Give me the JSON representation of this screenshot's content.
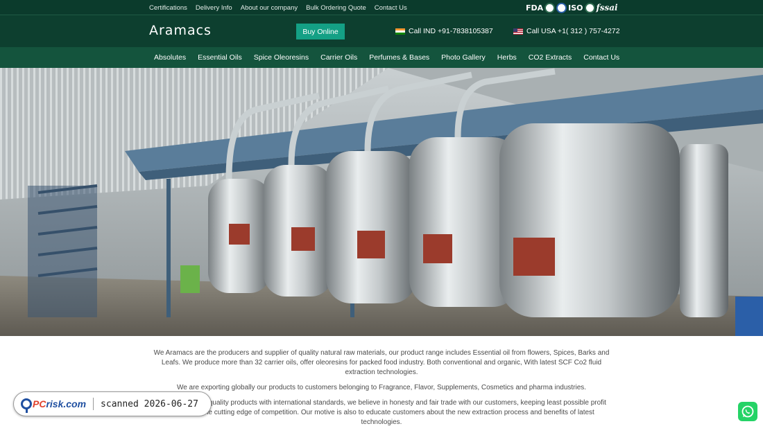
{
  "topbar": {
    "links": [
      "Certifications",
      "Delivery Info",
      "About our company",
      "Bulk Ordering Quote",
      "Contact Us"
    ],
    "certifications": [
      "FDA",
      "ISO",
      "fssai"
    ]
  },
  "header": {
    "logo": "Aramacs",
    "buy_online": "Buy Online",
    "call_ind": "Call IND +91-7838105387",
    "call_usa": "Call USA +1( 312 ) 757-4272"
  },
  "nav": {
    "items": [
      "Absolutes",
      "Essential Oils",
      "Spice Oleoresins",
      "Carrier Oils",
      "Perfumes & Bases",
      "Photo Gallery",
      "Herbs",
      "CO2 Extracts",
      "Contact Us"
    ]
  },
  "content": {
    "para1": "We Aramacs are the producers and supplier of quality natural raw materials, our product range includes Essential oil from flowers, Spices, Barks and Leafs. We produce more than 32 carrier oils, offer oleoresins for packed food industry. Both conventional and organic, With latest SCF Co2 fluid extraction technologies.",
    "para2": "We are exporting globally our products to customers belonging to Fragrance, Flavor, Supplements, Cosmetics and pharma industries.",
    "para3": "We provide high quality products with international standards, we believe in honesty and fair trade with our customers, keeping least possible profit margins in the cutting edge of competition. Our motive is also to educate customers about the new extraction process and benefits of latest technologies."
  },
  "watermark": {
    "brand": "PCrisk.com",
    "brand_pc": "PC",
    "brand_rest": "risk.com",
    "scanned": "scanned 2026-06-27"
  },
  "icons": [
    "in-flag-icon",
    "us-flag-icon",
    "whatsapp-icon",
    "pcrisk-logo-icon"
  ],
  "colors": {
    "topbar": "#0b3b2c",
    "header": "#0d3f2f",
    "nav": "#14543d",
    "buy_button": "#14a085",
    "whatsapp": "#25d366"
  }
}
